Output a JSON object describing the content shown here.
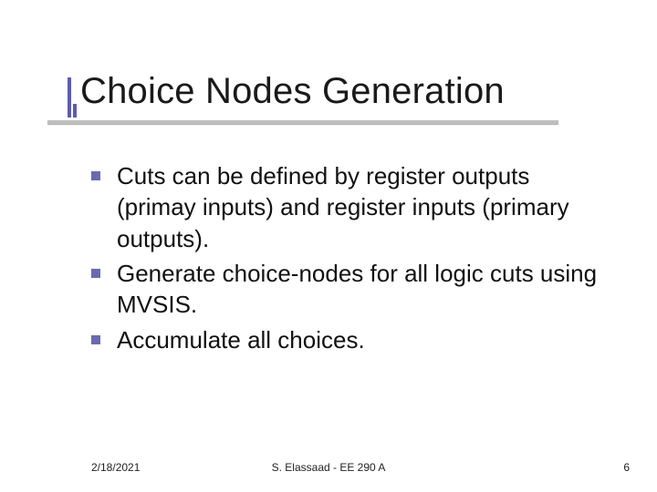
{
  "slide": {
    "title": "Choice Nodes Generation",
    "bullets": [
      "Cuts can be defined by register outputs (primay inputs) and register inputs (primary outputs).",
      "Generate choice-nodes for all logic cuts using MVSIS.",
      "Accumulate all choices."
    ],
    "footer": {
      "date": "2/18/2021",
      "author": "S. Elassaad - EE 290 A",
      "page": "6"
    }
  }
}
